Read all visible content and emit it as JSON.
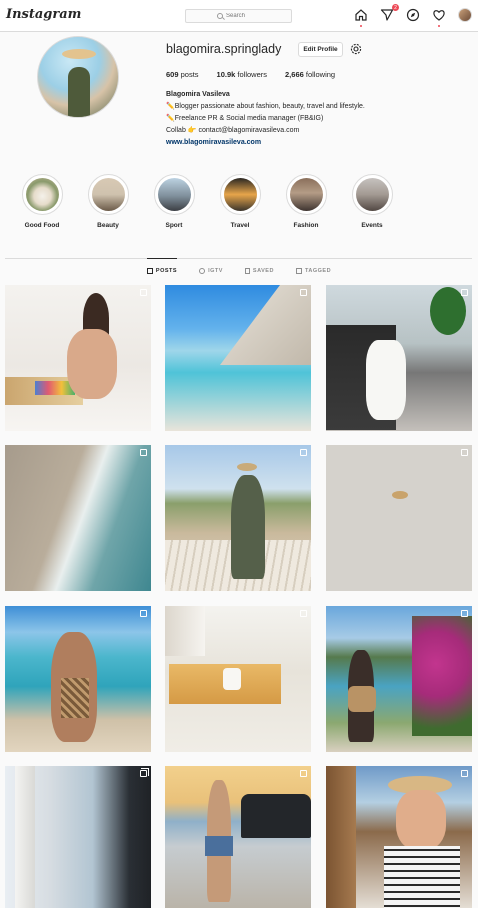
{
  "nav": {
    "logo": "Instagram",
    "search_placeholder": "Search",
    "activity_badge": "2"
  },
  "profile": {
    "username": "blagomira.springlady",
    "edit_label": "Edit Profile",
    "stats": [
      {
        "value": "609",
        "label": "posts"
      },
      {
        "value": "10.9k",
        "label": "followers"
      },
      {
        "value": "2,666",
        "label": "following"
      }
    ],
    "full_name": "Blagomira Vasileva",
    "bio_lines": [
      "✏️Blogger passionate about fashion, beauty, travel and lifestyle.",
      "✏️Freelance PR & Social media manager (FB&IG)",
      "Collab 👉 contact@blagomiravasileva.com"
    ],
    "website": "www.blagomiravasileva.com"
  },
  "highlights": [
    {
      "label": "Good Food"
    },
    {
      "label": "Beauty"
    },
    {
      "label": "Sport"
    },
    {
      "label": "Travel"
    },
    {
      "label": "Fashion"
    },
    {
      "label": "Events"
    }
  ],
  "tabs": [
    {
      "label": "POSTS",
      "active": true
    },
    {
      "label": "IGTV",
      "active": false
    },
    {
      "label": "SAVED",
      "active": false
    },
    {
      "label": "TAGGED",
      "active": false
    }
  ],
  "colors": {
    "accent_link": "#003569",
    "badge": "#ed4956",
    "border": "#dbdbdb",
    "background": "#fafafa"
  }
}
